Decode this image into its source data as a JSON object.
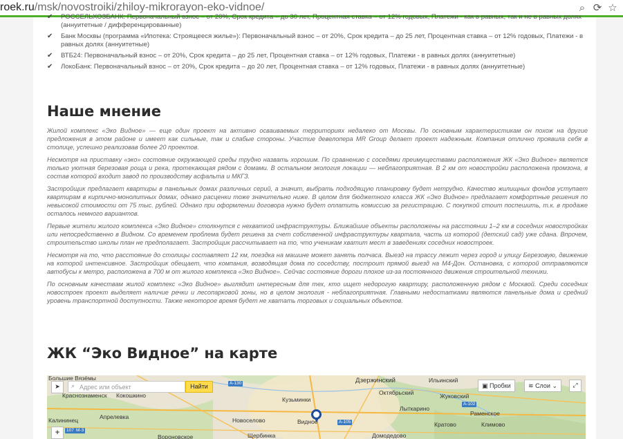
{
  "browser": {
    "url_host": "roek.ru",
    "url_path": "/msk/novostroiki/zhiloy-mikrorayon-eko-vidnoe/",
    "icons": [
      "search-icon",
      "reload-icon",
      "star-icon"
    ]
  },
  "mortgage_bullets": [
    "РОССЕЛЬХОЗБАНК: Первоначальный взнос – от 20%, Срок кредита – до 30 лет, Процентная ставка – от 12% годовых, Платежи - как в равных, так и не в равных долях (аннуитетные / дифференцированные)",
    "Банк Москвы (программа «Ипотека: Строящееся жилье»): Первоначальный взнос – от 20%, Срок кредита – до 25 лет, Процентная ставка – от 12% годовых, Платежи - в равных долях (аннуитетные)",
    "ВТБ24: Первоначальный взнос – от 20%, Срок кредита – до 25 лет, Процентная ставка – от 12% годовых, Платежи - в равных долях (аннуитетные)",
    "ЛокоБанк: Первоначальный взнос – от 20%, Срок кредита – до 20 лет, Процентная ставка – от 12% годовых, Платежи - в равных долях (аннуитетные)"
  ],
  "opinion": {
    "title": "Наше мнение",
    "paragraphs": [
      "Жилой комплекс «Эко Видное» — еще один проект на активно осваиваемых территориях недалеко от Москвы. По основным характеристикам он похож на другие предложения в этом районе и имеет как сильные, так и слабые стороны. Участие девелопера MR Group делает проект надежным. Компания отлично проявила себя в столице, успешно реализовав более 20 проектов.",
      "Несмотря на приставку «эко» состояние окружающей среды трудно назвать хорошим. По сравнению с соседями преимуществами расположения ЖК «Эко Видное» является только уютная березовая роща и река, протекающая рядом с домами. В остальном экология локации — неблагоприятная. В 2 км от новостройки расположена промзона, в состав которой входит завод по производству асфальта и МКГЗ.",
      "Застройщик предлагает квартиры в панельных домах различных серий, а значит, выбрать подходящую планировку будет нетрудно. Качество жилищных фондов уступает квартирам в кирпично-монолитных домах, однако расценки тоже значительно ниже. В целом для бюджетного класса ЖК «Эко Видное» предлагает комфортные решения по невысокой стоимости от 75 тыс. рублей. Однако при оформлении договора нужно будет оплатить комиссию за регистрацию. С покупкой стоит поспешить, т.к. в продаже осталось немного вариантов.",
      "Первые жители жилого комплекса «Эко Видное» столкнутся с нехваткой инфраструктуры. Ближайшие объекты расположены на расстоянии 1–2 км в соседних новостройках или непосредственно в Видном. Со временем проблема будет решена за счет собственной инфраструктуры квартала, часть из которой (детский сад) уже сдана. Впрочем, строительство школы план не предполагает. Застройщик рассчитывает на то, что ученикам хватит мест в заведениях соседних новостроек.",
      "Несмотря на то, что расстояние до столицы составляет 12 км, поездка на машине может занять полчаса. Выезд на трассу лежит через город и улицу Березовую, движение на которой интенсивное. Застройщик обещает, что компания, возводящая дома по соседству, построит прямой выезд на М4-Дон. Остановка, с которой отправляются автобусы к метро, расположена в 700 м от жилого комплекса «Эко Видное». Сейчас состояние дороги плохое из-за постоянного движения строительной техники.",
      "По основным качествам жилой комплекс «Эко Видное» выглядит интересным для тех, кто ищет недорогую квартиру, расположенную рядом с Москвой. Среди соседних новостроек проект выделяет наличие речки и лесопарковой зоны, но в целом экология - неблагоприятная. Главными недостатками являются панельные дома и средний уровень транспортной доступности. Также некоторое время будет не хватать торговых и социальных объектов."
    ]
  },
  "map_section": {
    "title": "ЖК “Эко Видное” на карте",
    "search_placeholder": "Адрес или объект",
    "find_button": "Найти",
    "traffic_button": "Пробки",
    "layers_button": "Слои",
    "places": [
      {
        "name": "Большие Вязёмы",
        "id": "bv"
      },
      {
        "name": "Краснознаменск",
        "id": "kz"
      },
      {
        "name": "Кокошкино",
        "id": "kk"
      },
      {
        "name": "Апрелевка",
        "id": "ap"
      },
      {
        "name": "Калининец",
        "id": "kl"
      },
      {
        "name": "Дзержинский",
        "id": "dz"
      },
      {
        "name": "Октябрьский",
        "id": "ok"
      },
      {
        "name": "Ильинский",
        "id": "il"
      },
      {
        "name": "Жуковский",
        "id": "zh"
      },
      {
        "name": "Лыткарино",
        "id": "lt"
      },
      {
        "name": "Видное",
        "id": "vd"
      },
      {
        "name": "Раменское",
        "id": "rm"
      },
      {
        "name": "Щербинка",
        "id": "sh"
      },
      {
        "name": "Домодедово",
        "id": "dm"
      },
      {
        "name": "Кратово",
        "id": "kr"
      },
      {
        "name": "Кузьминки",
        "id": "kzm"
      },
      {
        "name": "Новоселово",
        "id": "nv"
      },
      {
        "name": "Вороновское",
        "id": "vr"
      },
      {
        "name": "Климово",
        "id": "klm"
      }
    ],
    "roads": [
      "А-130",
      "А-105",
      "А-102",
      "М-3",
      "107"
    ]
  },
  "colors": {
    "accent_green": "#4caf2a",
    "map_pin": "#1e4c9a",
    "find_button": "#ffdb4d"
  }
}
